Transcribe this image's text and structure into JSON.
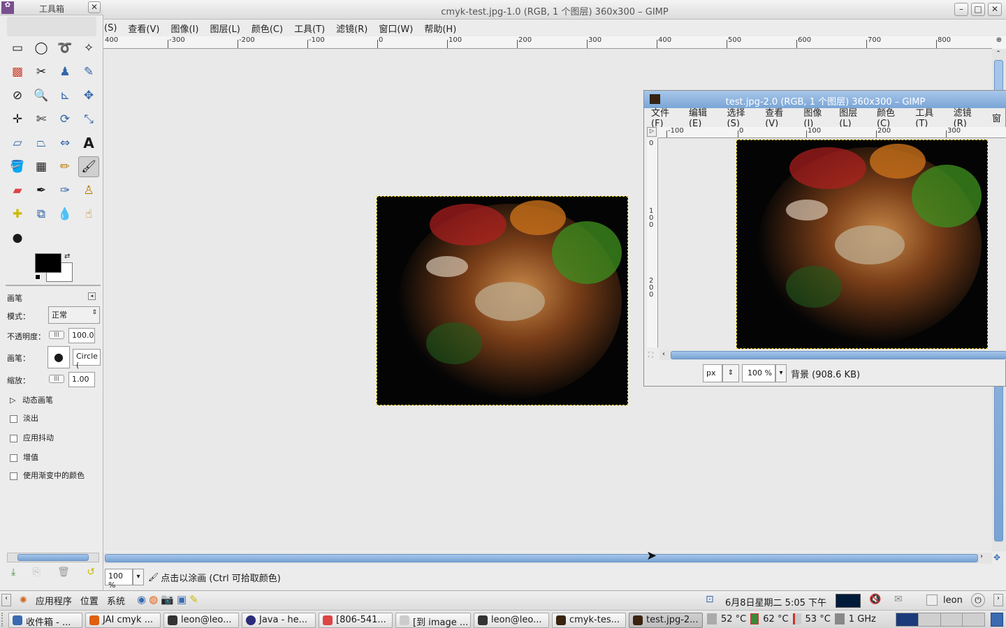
{
  "main_window": {
    "title": "cmyk-test.jpg-1.0 (RGB, 1 个图层) 360x300 – GIMP",
    "menu": [
      "(S)",
      "查看(V)",
      "图像(I)",
      "图层(L)",
      "颜色(C)",
      "工具(T)",
      "滤镜(R)",
      "窗口(W)",
      "帮助(H)"
    ],
    "ruler_labels": [
      "400",
      "-300",
      "-200",
      "-100",
      "0",
      "100",
      "200",
      "300",
      "400",
      "500",
      "600",
      "700",
      "800"
    ],
    "zoom": "100 %",
    "status": "点击以涂画 (Ctrl 可拾取颜色)"
  },
  "toolbox": {
    "title": "工具箱",
    "options_title": "画笔",
    "mode_label": "模式：",
    "mode_value": "正常",
    "opacity_label": "不透明度：",
    "opacity_value": "100.0",
    "brush_label": "画笔：",
    "brush_value": "Circle (",
    "scale_label": "缩放：",
    "scale_value": "1.00",
    "dynamics_label": "动态画笔",
    "checks": [
      "淡出",
      "应用抖动",
      "增值",
      "使用渐变中的颜色"
    ]
  },
  "second_window": {
    "title": "test.jpg-2.0 (RGB, 1 个图层) 360x300 – GIMP",
    "menu": [
      "文件(F)",
      "编辑(E)",
      "选择(S)",
      "查看(V)",
      "图像(I)",
      "图层(L)",
      "颜色(C)",
      "工具(T)",
      "滤镜(R)",
      "窗"
    ],
    "ruler_labels": [
      "-100",
      "0",
      "100",
      "200",
      "300"
    ],
    "vruler_labels": [
      "0",
      "1 0 0",
      "2 0 0"
    ],
    "unit": "px",
    "zoom": "100 %",
    "layer_info": "背景 (908.6 KB)"
  },
  "top_panel": {
    "menus": [
      "应用程序",
      "位置",
      "系统"
    ],
    "datetime": "6月8日星期二  5:05 下午",
    "user": "leon"
  },
  "taskbar": {
    "tasks": [
      "收件箱 - ...",
      "JAI cmyk ...",
      "leon@leo...",
      "Java - he...",
      "[806-541...",
      "[到 image ...",
      "leon@leo...",
      "cmyk-tes...",
      "test.jpg-2..."
    ],
    "active_index": 8,
    "temps": [
      "52 °C",
      "62 °C",
      "53 °C"
    ],
    "cpu_freq": "1 GHz"
  },
  "colors": {
    "accent": "#7aa5d6",
    "selection": "#e8d000"
  }
}
